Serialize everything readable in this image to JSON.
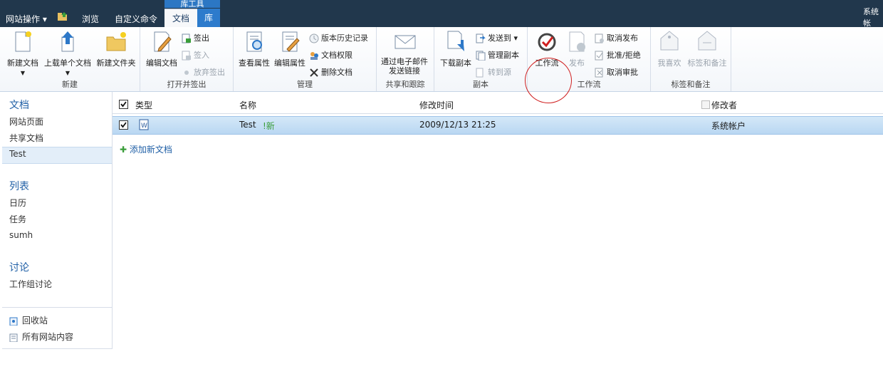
{
  "topbar": {
    "site_actions": "网站操作",
    "browse": "浏览",
    "custom_commands": "自定义命令",
    "tool_group": "库工具",
    "tab_documents": "文档",
    "tab_library": "库",
    "user": "系统帐"
  },
  "ribbon": {
    "new_group": {
      "label": "新建",
      "new_document": "新建文档",
      "upload_document": "上载单个文档",
      "new_folder": "新建文件夹"
    },
    "checkout_group": {
      "label": "打开并签出",
      "edit_document": "编辑文档",
      "check_out": "签出",
      "check_in": "签入",
      "discard_checkout": "放弃签出"
    },
    "manage_group": {
      "label": "管理",
      "view_properties": "查看属性",
      "edit_properties": "编辑属性",
      "version_history": "版本历史记录",
      "document_permissions": "文档权限",
      "delete_document": "删除文档"
    },
    "share_group": {
      "label": "共享和跟踪",
      "email_link": "通过电子邮件发送链接"
    },
    "copies_group": {
      "label": "副本",
      "download_copy": "下载副本",
      "send_to": "发送到",
      "manage_copies": "管理副本",
      "go_to_source": "转到源"
    },
    "workflow_group": {
      "label": "工作流",
      "workflows": "工作流",
      "publish": "发布",
      "unpublish": "取消发布",
      "approve_reject": "批准/拒绝",
      "cancel_approval": "取消审批"
    },
    "tags_group": {
      "label": "标签和备注",
      "i_like_it": "我喜欢",
      "tags_notes": "标签和备注"
    }
  },
  "leftnav": {
    "documents_heading": "文档",
    "site_pages": "网站页面",
    "shared_documents": "共享文档",
    "test": "Test",
    "lists_heading": "列表",
    "calendar": "日历",
    "tasks": "任务",
    "sumh": "sumh",
    "discussions_heading": "讨论",
    "team_discussion": "工作组讨论",
    "recycle_bin": "回收站",
    "all_site_content": "所有网站内容"
  },
  "grid": {
    "col_type": "类型",
    "col_name": "名称",
    "col_modified": "修改时间",
    "col_modified_by": "修改者",
    "rows": [
      {
        "name": "Test",
        "new_badge": "!新",
        "modified": "2009/12/13 21:25",
        "modified_by": "系统帐户"
      }
    ],
    "add_new": "添加新文档"
  },
  "colors": {
    "topbar": "#21374c",
    "accent": "#2c77c4",
    "link": "#1f5fa6",
    "selected_row": "#c7e0f6"
  }
}
